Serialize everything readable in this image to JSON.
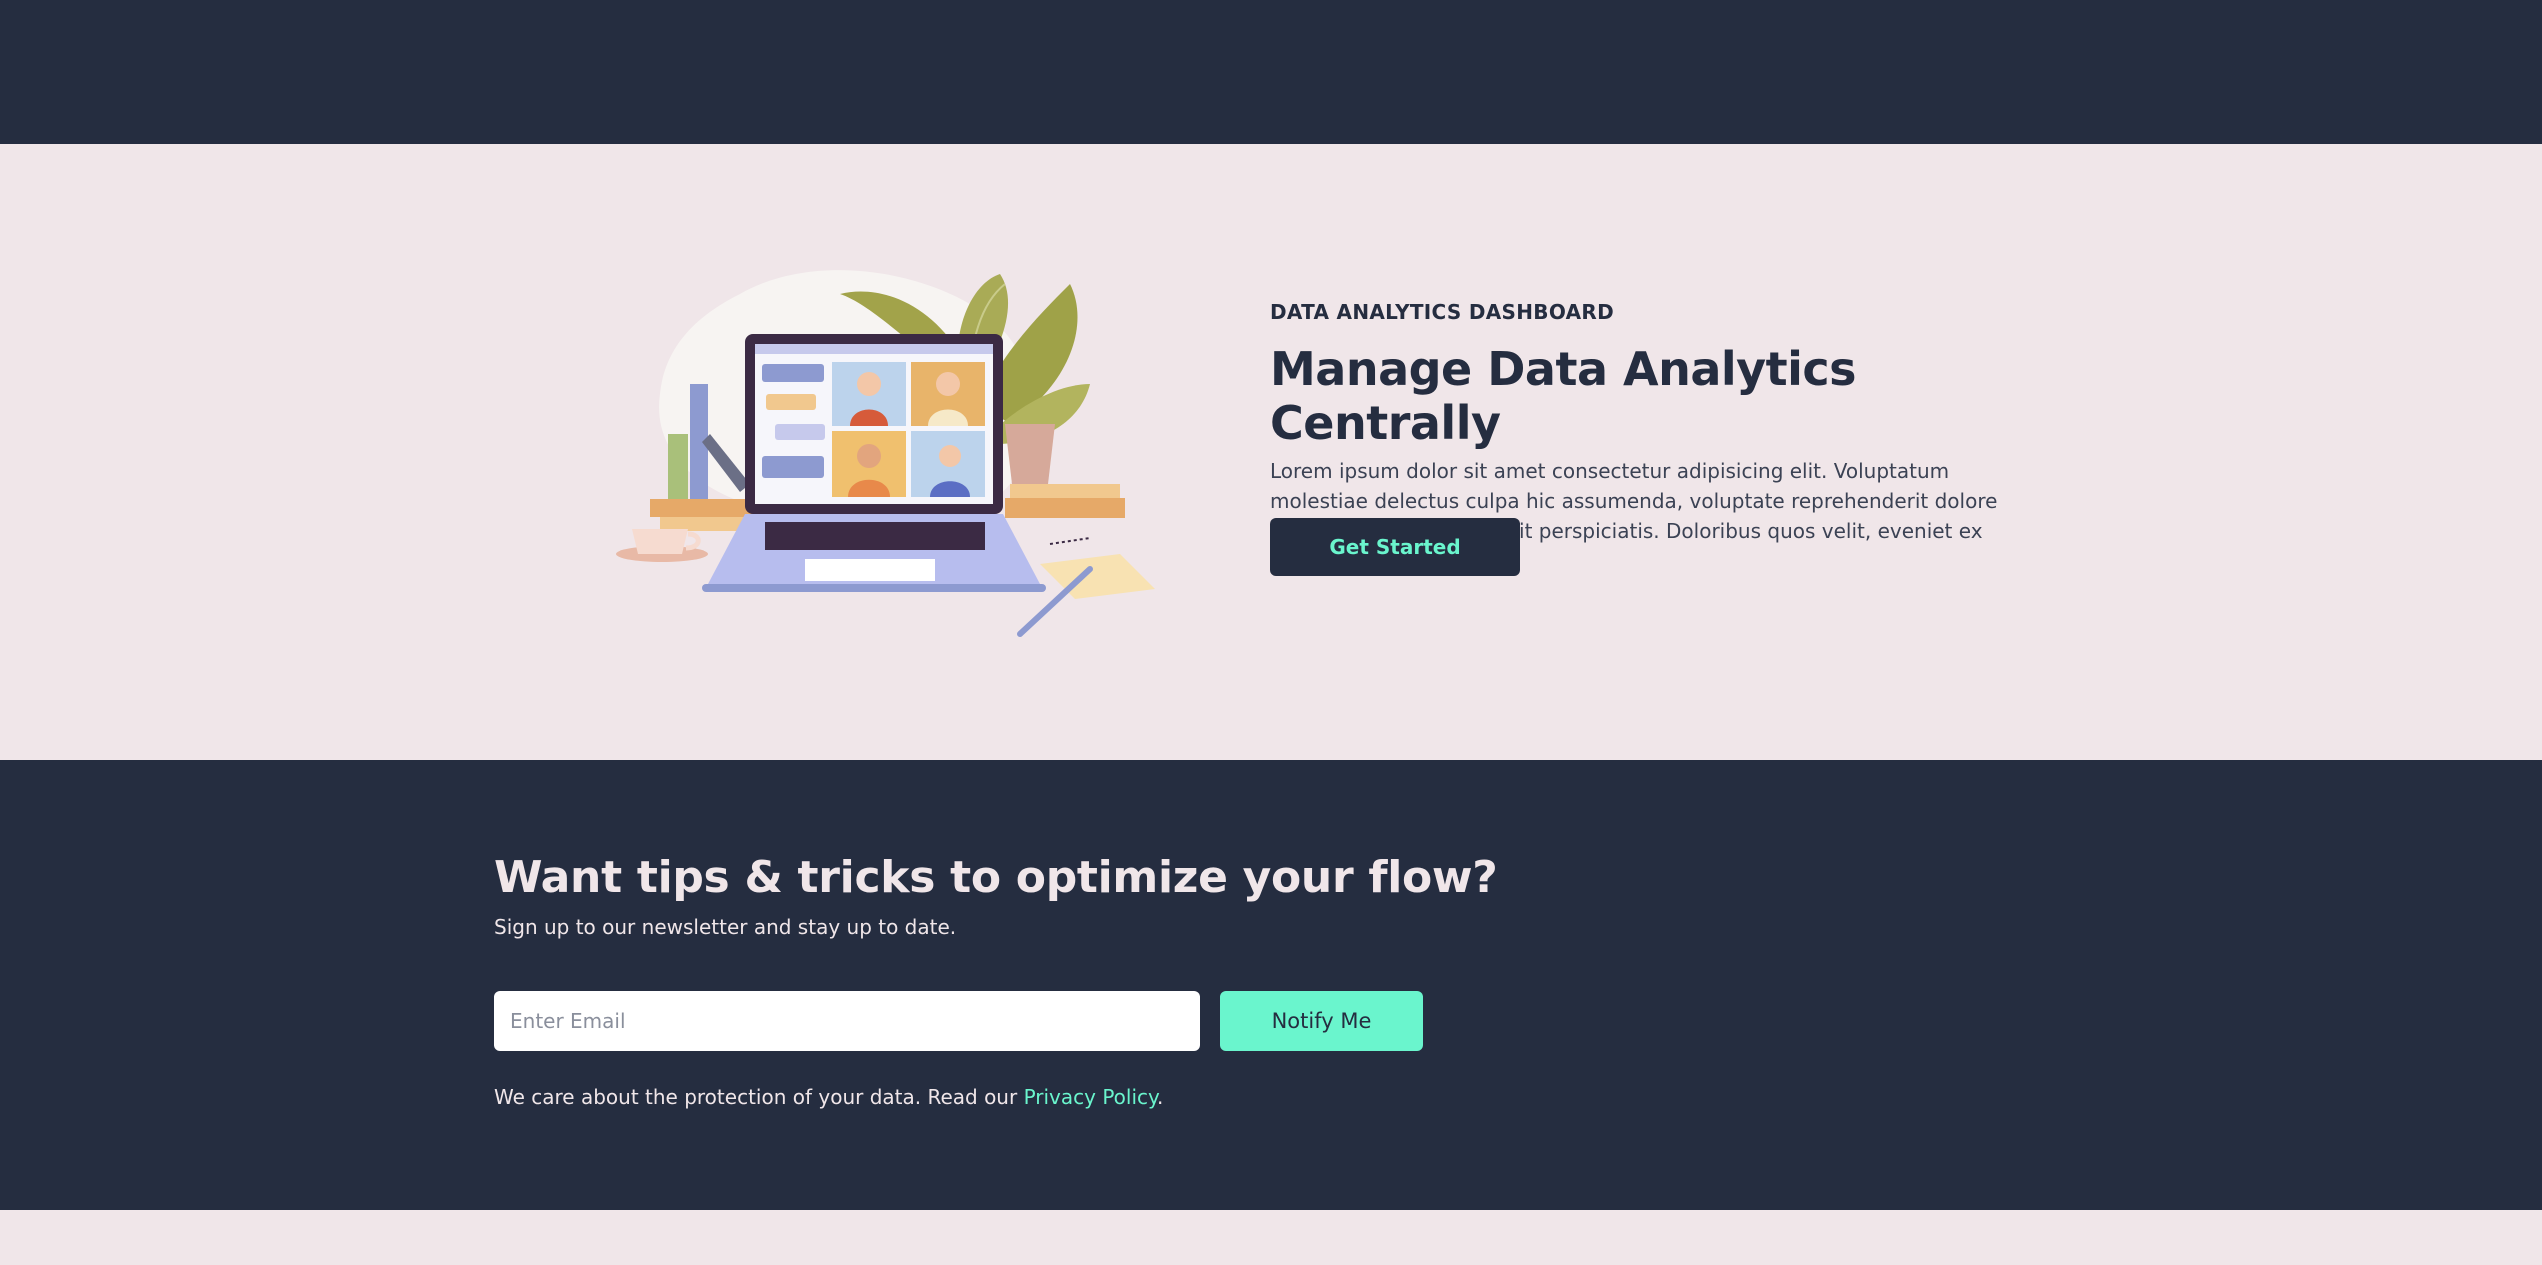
{
  "hero": {
    "eyebrow": "DATA ANALYTICS DASHBOARD",
    "title": "Manage Data Analytics Centrally",
    "description": "Lorem ipsum dolor sit amet consectetur adipisicing elit. Voluptatum molestiae delectus culpa hic assumenda, voluptate reprehenderit dolore autem cum ullam sed odit perspiciatis. Doloribus quos velit, eveniet ex deserunt fuga?",
    "cta_label": "Get Started"
  },
  "newsletter": {
    "title": "Want tips & tricks to optimize your flow?",
    "subtitle": "Sign up to our newsletter and stay up to date.",
    "email_placeholder": "Enter Email",
    "email_value": "",
    "notify_label": "Notify Me",
    "privacy_prefix": "We care about the protection of your data. Read our ",
    "privacy_link": "Privacy Policy",
    "privacy_suffix": "."
  },
  "colors": {
    "navy": "#252d40",
    "blush": "#f0e6e9",
    "mint": "#6af5cd"
  },
  "icons": {
    "illustration": "laptop-video-call-illustration"
  }
}
